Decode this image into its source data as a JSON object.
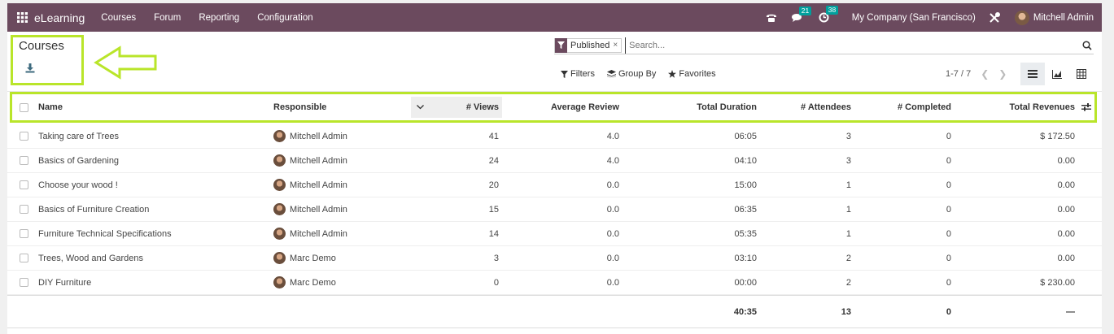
{
  "navbar": {
    "app_name": "eLearning",
    "menus": [
      "Courses",
      "Forum",
      "Reporting",
      "Configuration"
    ],
    "messages_count": "21",
    "activities_count": "38",
    "company": "My Company (San Francisco)",
    "user": "Mitchell Admin",
    "bg_color": "#6b4a5e"
  },
  "control": {
    "title": "Courses",
    "facet_label": "Published",
    "facet_remove": "×",
    "search_placeholder": "Search...",
    "filters_label": "Filters",
    "groupby_label": "Group By",
    "favorites_label": "Favorites",
    "pager": "1-7 / 7",
    "highlight_color": "#b9e52a"
  },
  "table": {
    "columns": {
      "name": "Name",
      "responsible": "Responsible",
      "views": "# Views",
      "avg_review": "Average Review",
      "duration": "Total Duration",
      "attendees": "# Attendees",
      "completed": "# Completed",
      "revenues": "Total Revenues"
    },
    "rows": [
      {
        "name": "Taking care of Trees",
        "responsible": "Mitchell Admin",
        "views": "41",
        "avg_review": "4.0",
        "duration": "06:05",
        "attendees": "3",
        "completed": "0",
        "revenues": "$ 172.50"
      },
      {
        "name": "Basics of Gardening",
        "responsible": "Mitchell Admin",
        "views": "24",
        "avg_review": "4.0",
        "duration": "04:10",
        "attendees": "3",
        "completed": "0",
        "revenues": "0.00"
      },
      {
        "name": "Choose your wood !",
        "responsible": "Mitchell Admin",
        "views": "20",
        "avg_review": "0.0",
        "duration": "15:00",
        "attendees": "1",
        "completed": "0",
        "revenues": "0.00"
      },
      {
        "name": "Basics of Furniture Creation",
        "responsible": "Mitchell Admin",
        "views": "15",
        "avg_review": "0.0",
        "duration": "06:35",
        "attendees": "1",
        "completed": "0",
        "revenues": "0.00"
      },
      {
        "name": "Furniture Technical Specifications",
        "responsible": "Mitchell Admin",
        "views": "14",
        "avg_review": "0.0",
        "duration": "05:35",
        "attendees": "1",
        "completed": "0",
        "revenues": "0.00"
      },
      {
        "name": "Trees, Wood and Gardens",
        "responsible": "Marc Demo",
        "views": "3",
        "avg_review": "0.0",
        "duration": "03:10",
        "attendees": "2",
        "completed": "0",
        "revenues": "0.00"
      },
      {
        "name": "DIY Furniture",
        "responsible": "Marc Demo",
        "views": "0",
        "avg_review": "0.0",
        "duration": "00:00",
        "attendees": "2",
        "completed": "0",
        "revenues": "$ 230.00"
      }
    ],
    "totals": {
      "duration": "40:35",
      "attendees": "13",
      "completed": "0",
      "revenues": "—"
    }
  }
}
